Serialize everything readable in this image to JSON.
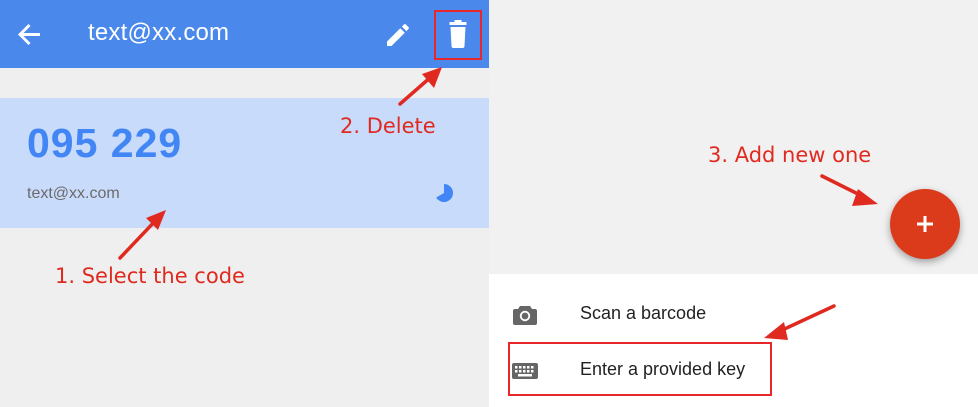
{
  "appbar": {
    "title": "text@xx.com",
    "back_icon": "arrow-back-icon",
    "edit_icon": "pencil-icon",
    "delete_icon": "trash-icon",
    "color": "#4a88ec"
  },
  "code_card": {
    "code": "095 229",
    "account": "text@xx.com",
    "timer_icon": "countdown-pie-icon",
    "background": "#c9dbfb"
  },
  "annotations": {
    "select": "1. Select the code",
    "delete": "2. Delete",
    "add": "3. Add new one",
    "color": "#e02a20"
  },
  "fab": {
    "icon": "plus-icon",
    "color": "#db3a1b"
  },
  "sheet": {
    "items": [
      {
        "label": "Scan a barcode",
        "icon": "camera-icon"
      },
      {
        "label": "Enter a provided key",
        "icon": "keyboard-icon"
      }
    ]
  }
}
